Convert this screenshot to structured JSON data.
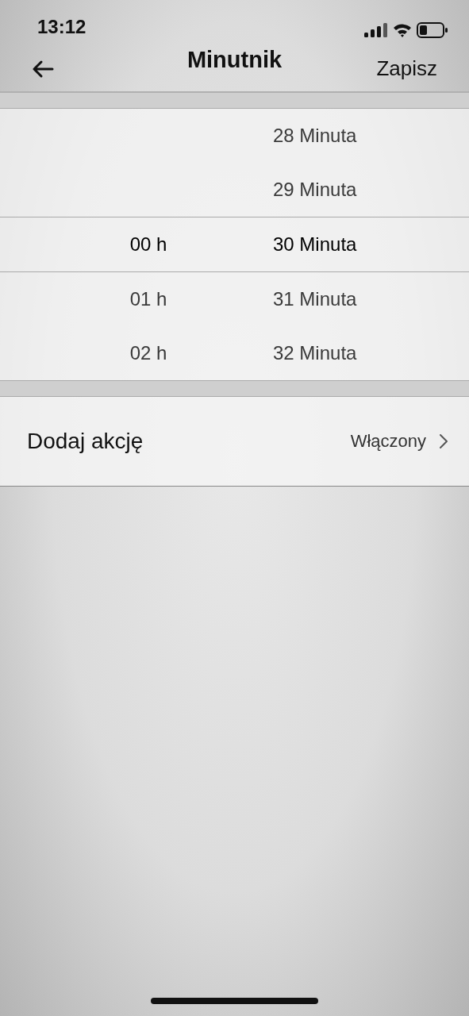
{
  "status_bar": {
    "time": "13:12"
  },
  "nav": {
    "title": "Minutnik",
    "action": "Zapisz"
  },
  "picker": {
    "rows": [
      {
        "minute": "28 Minuta",
        "selected": false
      },
      {
        "minute": "29 Minuta",
        "selected": false
      },
      {
        "hour": "00 h",
        "minute": "30 Minuta",
        "selected": true
      },
      {
        "hour": "01 h",
        "minute": "31 Minuta",
        "selected": false
      },
      {
        "hour": "02 h",
        "minute": "32 Minuta",
        "selected": false
      }
    ]
  },
  "action_row": {
    "label": "Dodaj akcję",
    "value": "Włączony"
  }
}
